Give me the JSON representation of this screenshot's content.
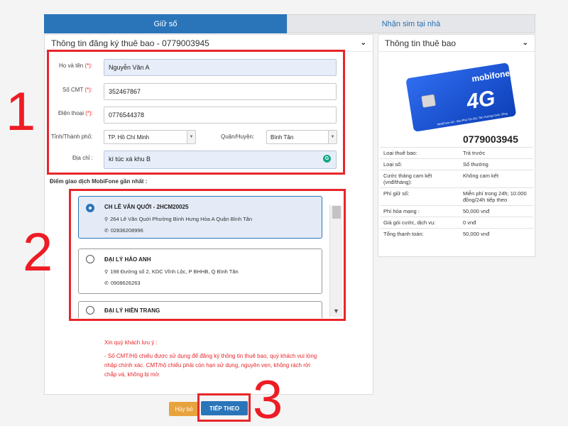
{
  "tabs": {
    "active": "Giữ số",
    "inactive": "Nhận sim tại nhà"
  },
  "left_panel": {
    "title": "Thông tin đăng ký thuê bao - 0779003945"
  },
  "right_panel": {
    "title": "Thông tin thuê bao"
  },
  "form": {
    "name": {
      "label": "Họ và tên",
      "req": "(*):",
      "value": "Nguyễn Văn A"
    },
    "id_card": {
      "label": "Số CMT",
      "req": "(*):",
      "value": "352467867"
    },
    "phone": {
      "label": "Điện thoại",
      "req": "(*):",
      "value": "0776544378"
    },
    "province": {
      "label": "Tỉnh/Thành phố:",
      "value": "TP. Hồ Chí Minh"
    },
    "district": {
      "label": "Quận/Huyện:",
      "value": "Bình Tân"
    },
    "address": {
      "label": "Địa chỉ :",
      "value": "kí túc xá khu B"
    }
  },
  "stores_label": "Điểm giao dịch MobiFone gần nhất :",
  "stores": [
    {
      "name": "CH LÊ VĂN QUỚI - 2HCM20025",
      "address": "264 Lê Văn Quới Phường Bình Hưng Hòa A Quận Bình Tân",
      "phone": "02836208996"
    },
    {
      "name": "ĐẠI LÝ HẢO ANH",
      "address": "198 Đường số 2, KDC Vĩnh Lộc, P BHHB, Q Bình Tân",
      "phone": "0908626263"
    },
    {
      "name": "ĐẠI LÝ HIỀN TRANG"
    }
  ],
  "notes": {
    "title": "Xin quý khách lưu ý :",
    "body": "- Số CMT/Hộ chiếu được sử dụng để đăng ký thông tin thuê bao, quý khách vui lòng nhập chính xác. CMT/hộ chiếu phải còn hạn sử dụng, nguyên vẹn, không rách rời chắp vá, không bị mờ."
  },
  "buttons": {
    "cancel": "Hủy bỏ",
    "next": "TIẾP THEO"
  },
  "annotations": {
    "one": "1",
    "two": "2",
    "three": "3"
  },
  "sim": {
    "brand": "mobifone",
    "network": "4G",
    "tagline": "MobiFone 4G - Bứt Phá Tốc Độ, Tận Hưởng Cuộc Sống",
    "number": "0779003945"
  },
  "info": [
    {
      "k": "Loại thuê bao:",
      "v": "Trả trước"
    },
    {
      "k": "Loại số:",
      "v": "Số thường"
    },
    {
      "k": "Cước tháng cam kết (vnđ/tháng):",
      "v": "Không cam kết"
    },
    {
      "k": "Phí giữ số:",
      "v": "Miễn phí trong 24h; 10.000 đồng/24h tiếp theo"
    },
    {
      "k": "Phí hòa mạng :",
      "v": "50,000 vnđ"
    },
    {
      "k": "Giá gói cước, dịch vụ:",
      "v": "0 vnđ"
    },
    {
      "k": "Tổng thanh toán:",
      "v": "50,000 vnđ"
    }
  ],
  "colors": {
    "primary": "#2a75b9",
    "highlight_red": "#e8262b",
    "cancel": "#e8a33d"
  }
}
